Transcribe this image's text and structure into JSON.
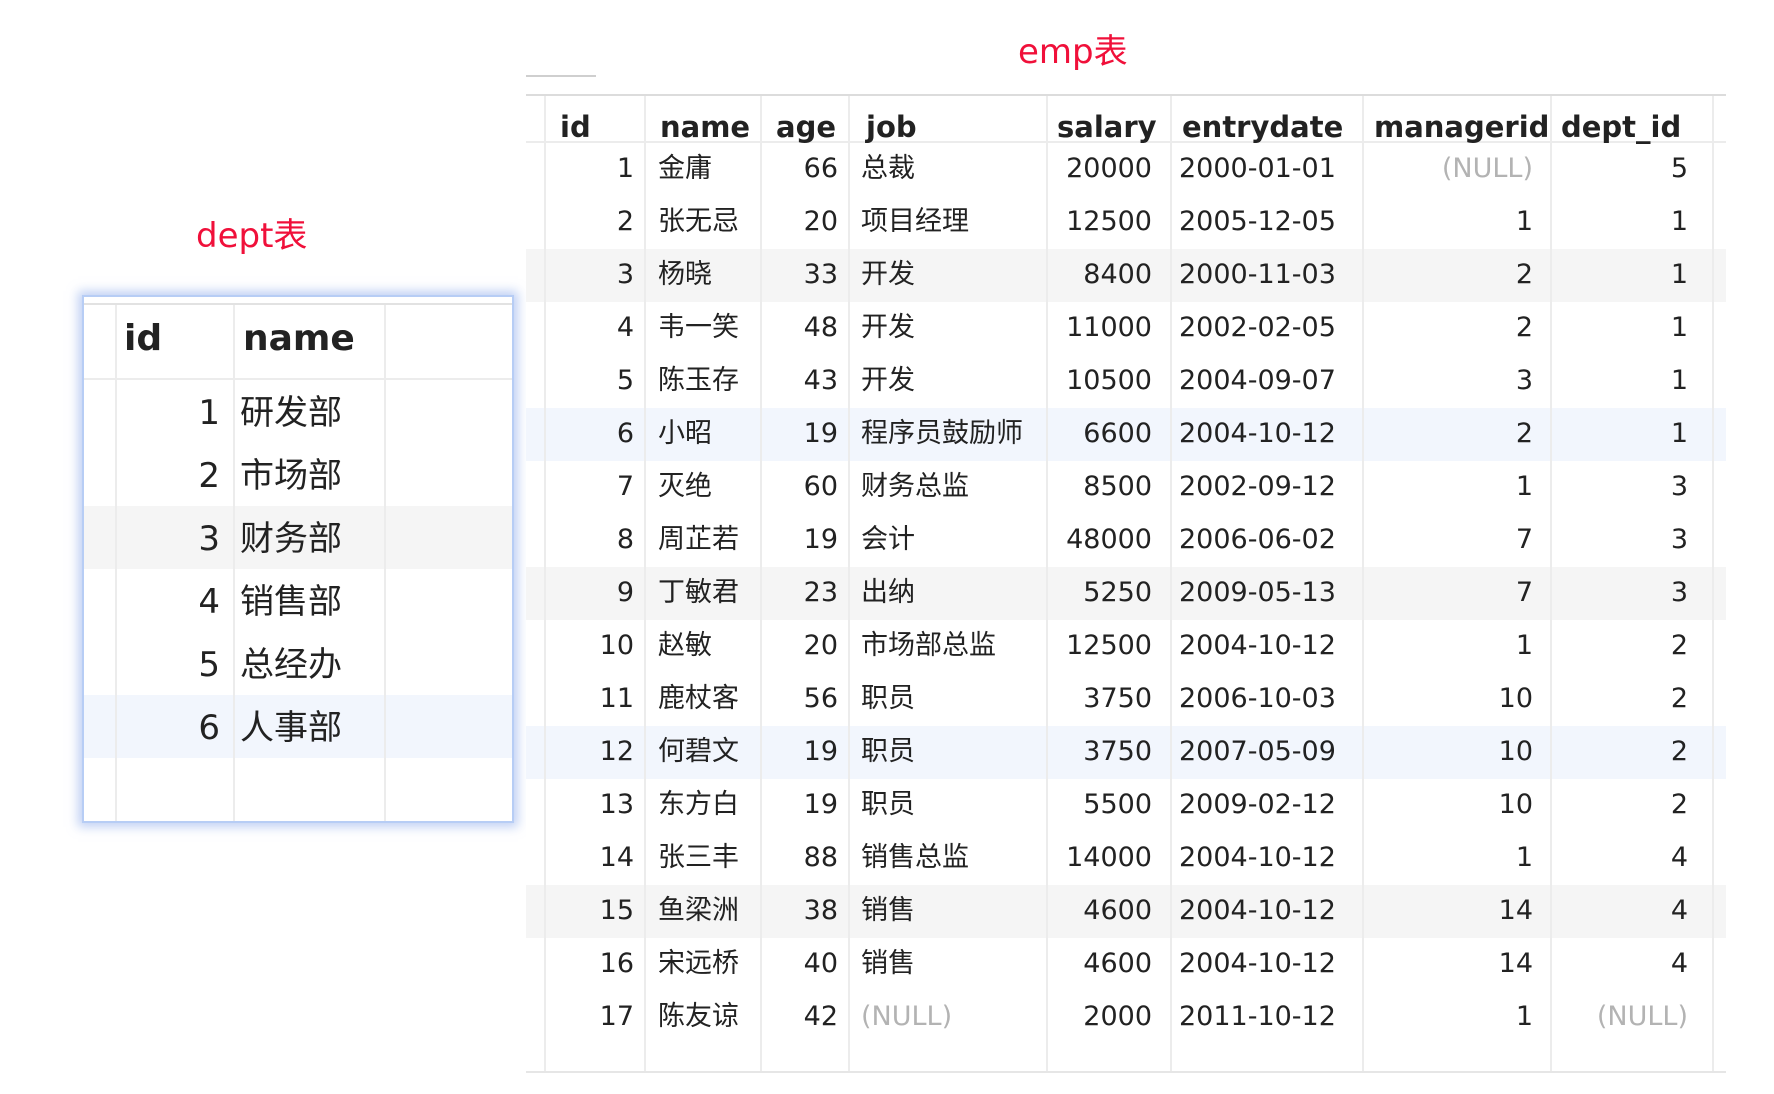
{
  "dept": {
    "caption": "dept表",
    "columns": [
      "id",
      "name"
    ],
    "rows": [
      [
        "1",
        "研发部"
      ],
      [
        "2",
        "市场部"
      ],
      [
        "3",
        "财务部"
      ],
      [
        "4",
        "销售部"
      ],
      [
        "5",
        "总经办"
      ],
      [
        "6",
        "人事部"
      ]
    ]
  },
  "emp": {
    "caption": "emp表",
    "columns": [
      "id",
      "name",
      "age",
      "job",
      "salary",
      "entrydate",
      "managerid",
      "dept_id"
    ],
    "rows": [
      [
        "1",
        "金庸",
        "66",
        "总裁",
        "20000",
        "2000-01-01",
        "(NULL)",
        "5"
      ],
      [
        "2",
        "张无忌",
        "20",
        "项目经理",
        "12500",
        "2005-12-05",
        "1",
        "1"
      ],
      [
        "3",
        "杨晓",
        "33",
        "开发",
        "8400",
        "2000-11-03",
        "2",
        "1"
      ],
      [
        "4",
        "韦一笑",
        "48",
        "开发",
        "11000",
        "2002-02-05",
        "2",
        "1"
      ],
      [
        "5",
        "陈玉存",
        "43",
        "开发",
        "10500",
        "2004-09-07",
        "3",
        "1"
      ],
      [
        "6",
        "小昭",
        "19",
        "程序员鼓励师",
        "6600",
        "2004-10-12",
        "2",
        "1"
      ],
      [
        "7",
        "灭绝",
        "60",
        "财务总监",
        "8500",
        "2002-09-12",
        "1",
        "3"
      ],
      [
        "8",
        "周芷若",
        "19",
        "会计",
        "48000",
        "2006-06-02",
        "7",
        "3"
      ],
      [
        "9",
        "丁敏君",
        "23",
        "出纳",
        "5250",
        "2009-05-13",
        "7",
        "3"
      ],
      [
        "10",
        "赵敏",
        "20",
        "市场部总监",
        "12500",
        "2004-10-12",
        "1",
        "2"
      ],
      [
        "11",
        "鹿杖客",
        "56",
        "职员",
        "3750",
        "2006-10-03",
        "10",
        "2"
      ],
      [
        "12",
        "何碧文",
        "19",
        "职员",
        "3750",
        "2007-05-09",
        "10",
        "2"
      ],
      [
        "13",
        "东方白",
        "19",
        "职员",
        "5500",
        "2009-02-12",
        "10",
        "2"
      ],
      [
        "14",
        "张三丰",
        "88",
        "销售总监",
        "14000",
        "2004-10-12",
        "1",
        "4"
      ],
      [
        "15",
        "鱼梁洲",
        "38",
        "销售",
        "4600",
        "2004-10-12",
        "14",
        "4"
      ],
      [
        "16",
        "宋远桥",
        "40",
        "销售",
        "4600",
        "2004-10-12",
        "14",
        "4"
      ],
      [
        "17",
        "陈友谅",
        "42",
        "(NULL)",
        "2000",
        "2011-10-12",
        "1",
        "(NULL)"
      ]
    ]
  },
  "colors": {
    "caption": "#f0103a",
    "null_text": "#b3b3b3",
    "stripe": "#f5f5f5",
    "selected_row": "#f2f6fd",
    "grid": "#ececec",
    "focus_border": "#b7cdf5"
  }
}
